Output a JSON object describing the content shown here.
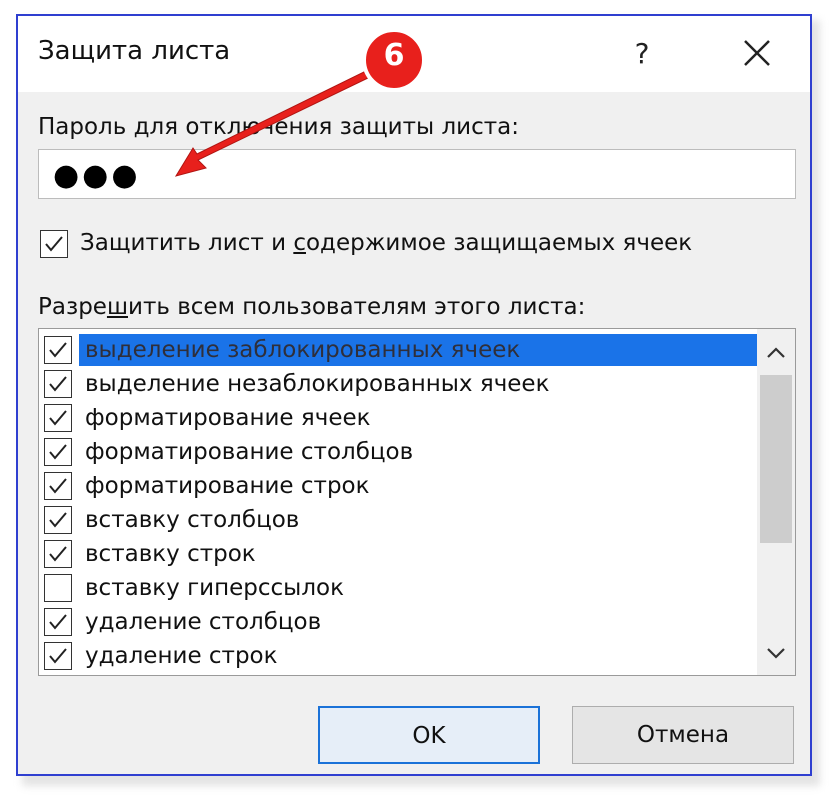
{
  "dialog": {
    "title": "Защита листа",
    "help_label": "?",
    "close_icon": "close-icon"
  },
  "password": {
    "label": "Пароль для отключения защиты листа:",
    "value": "●●●"
  },
  "protect": {
    "label_before": "Защитить лист и ",
    "label_underlined": "с",
    "label_after": "одержимое защищаемых ячеек",
    "checked": true
  },
  "permissions": {
    "label_before": "Разре",
    "label_underlined": "ш",
    "label_after": "ить всем пользователям этого листа:",
    "items": [
      {
        "label": "выделение заблокированных ячеек",
        "checked": true,
        "selected": true
      },
      {
        "label": "выделение незаблокированных ячеек",
        "checked": true,
        "selected": false
      },
      {
        "label": "форматирование ячеек",
        "checked": true,
        "selected": false
      },
      {
        "label": "форматирование столбцов",
        "checked": true,
        "selected": false
      },
      {
        "label": "форматирование строк",
        "checked": true,
        "selected": false
      },
      {
        "label": "вставку столбцов",
        "checked": true,
        "selected": false
      },
      {
        "label": "вставку строк",
        "checked": true,
        "selected": false
      },
      {
        "label": "вставку гиперссылок",
        "checked": false,
        "selected": false
      },
      {
        "label": "удаление столбцов",
        "checked": true,
        "selected": false
      },
      {
        "label": "удаление строк",
        "checked": true,
        "selected": false
      }
    ]
  },
  "buttons": {
    "ok": "OK",
    "cancel": "Отмена"
  },
  "annotation": {
    "badge_text": "6",
    "color": "#e8201c"
  },
  "colors": {
    "dialog_border": "#2f3fd0",
    "selection": "#1a73e8",
    "ok_border": "#1b72d8"
  }
}
